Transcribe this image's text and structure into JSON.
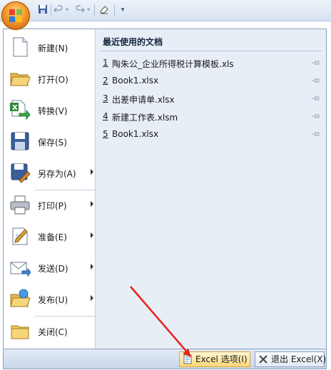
{
  "menu": {
    "items": [
      {
        "label": "新建(N)",
        "icon": "new-document-icon"
      },
      {
        "label": "打开(O)",
        "icon": "open-folder-icon"
      },
      {
        "label": "转换(V)",
        "icon": "convert-excel-icon"
      },
      {
        "label": "保存(S)",
        "icon": "save-disk-icon"
      },
      {
        "label": "另存为(A)",
        "icon": "save-as-icon"
      },
      {
        "label": "打印(P)",
        "icon": "printer-icon"
      },
      {
        "label": "准备(E)",
        "icon": "prepare-icon"
      },
      {
        "label": "发送(D)",
        "icon": "send-mail-icon"
      },
      {
        "label": "发布(U)",
        "icon": "publish-folder-icon"
      },
      {
        "label": "关闭(C)",
        "icon": "close-folder-icon"
      }
    ]
  },
  "recent": {
    "title": "最近使用的文档",
    "docs": [
      {
        "num": "1",
        "name": "陶朱公_企业所得税计算模板.xls"
      },
      {
        "num": "2",
        "name": "Book1.xlsx"
      },
      {
        "num": "3",
        "name": "出差申请单.xlsx"
      },
      {
        "num": "4",
        "name": "新建工作表.xlsm"
      },
      {
        "num": "5",
        "name": "Book1.xlsx"
      }
    ]
  },
  "bottom": {
    "options_label": "Excel 选项(I)",
    "exit_label": "退出 Excel(X)"
  },
  "colors": {
    "accent": "#f59a2a",
    "annotation": "#e8241e",
    "panel": "#e8eef6"
  }
}
